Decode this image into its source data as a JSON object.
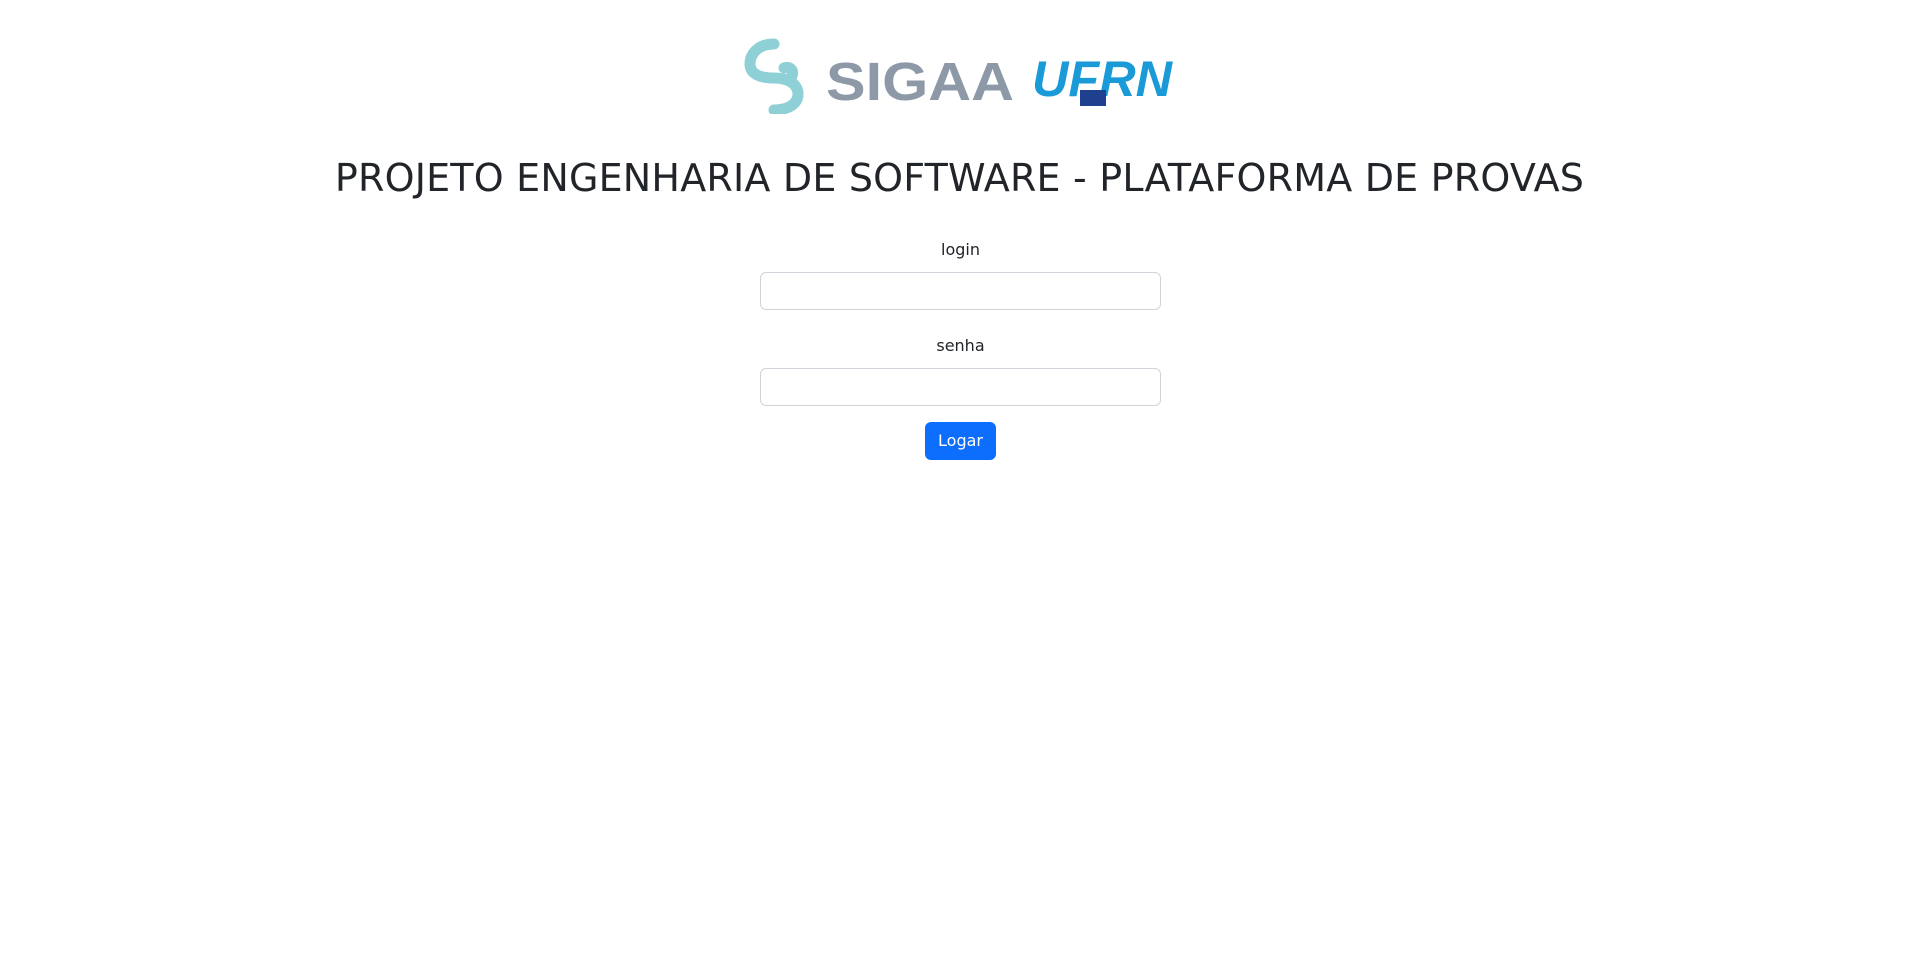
{
  "header": {
    "logo": {
      "sigaa_text": "SIGAA",
      "ufrn_text": "UFRN",
      "sigaa_color": "#8e99a8",
      "symbol_color": "#8fd0d6",
      "ufrn_light_color": "#1a9ad6",
      "ufrn_dark_color": "#1f3f8f"
    },
    "title": "PROJETO ENGENHARIA DE SOFTWARE - PLATAFORMA DE PROVAS"
  },
  "form": {
    "login_label": "login",
    "login_value": "",
    "senha_label": "senha",
    "senha_value": "",
    "submit_label": "Logar",
    "submit_color": "#0d6efd"
  }
}
